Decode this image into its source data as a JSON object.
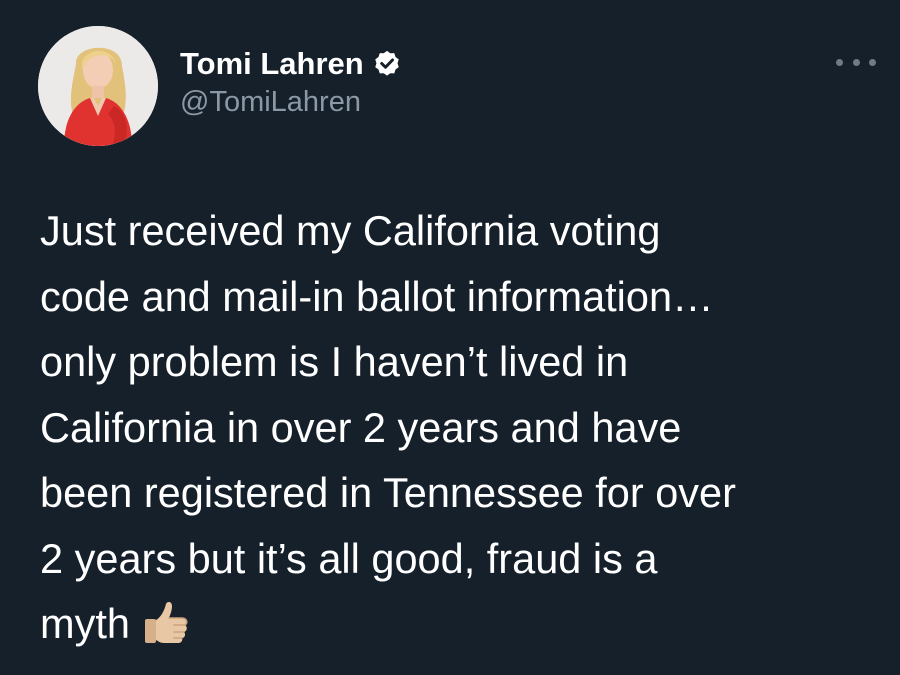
{
  "author": {
    "display_name": "Tomi Lahren",
    "handle": "@TomiLahren",
    "verified": true,
    "avatar_icon": "profile-photo"
  },
  "tweet": {
    "lines": [
      "Just received my California voting",
      "code and mail-in ballot information…",
      "only problem is I haven’t lived in",
      "California in over 2 years and have",
      "been registered in Tennessee for over",
      "2 years but it’s all good, fraud is a",
      "myth"
    ],
    "emoji": "thumbs-up-icon"
  },
  "menu_icon": "more-options-icon",
  "colors": {
    "background": "#15202b",
    "text": "#ffffff",
    "secondary_text": "#8b98a5",
    "verified_badge": "#ffffff"
  }
}
